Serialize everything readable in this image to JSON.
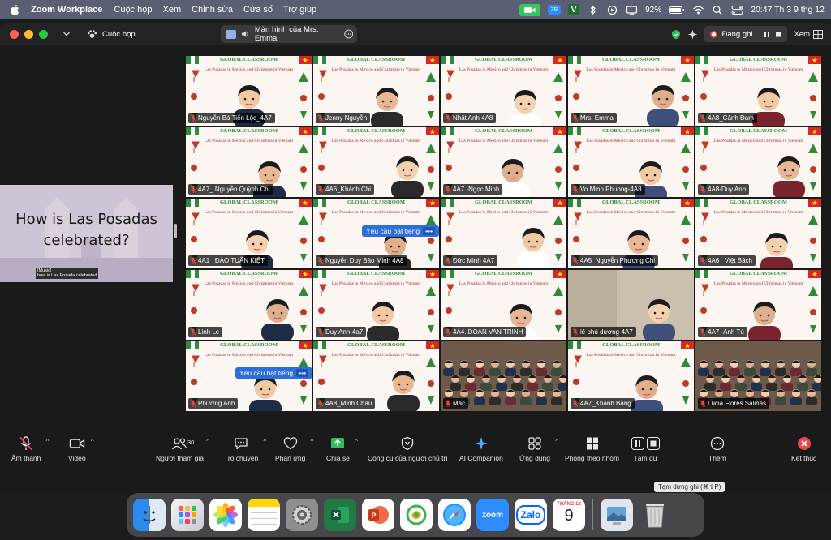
{
  "menubar": {
    "app_name": "Zoom Workplace",
    "items": [
      "Cuộc họp",
      "Xem",
      "Chỉnh sửa",
      "Cửa sổ",
      "Trợ giúp"
    ],
    "zoom_badge": "ZR",
    "v_badge": "V",
    "battery": "92%",
    "clock": "20:47 Th 3 9 thg 12"
  },
  "window": {
    "meeting_label": "Cuộc họp",
    "share_tab_label": "Màn hình của Mrs. Emma",
    "recording_label": "Đang ghi...",
    "view_label": "Xem"
  },
  "shared_screen": {
    "title": "How is Las Posadas celebrated?",
    "caption_line1": "[Music]",
    "caption_line2": "how is Las Posada celebrated"
  },
  "slide": {
    "header": "GLOBAL CLASSROOM",
    "line1": "Las Posadas in Mexico and",
    "line2": "Christmas in Vietnam"
  },
  "participants": [
    {
      "name": "Nguyễn Bá Tiến Lộc_4A7",
      "kind": "slide"
    },
    {
      "name": "Jenny Nguyễn",
      "kind": "slide"
    },
    {
      "name": "Nhật Anh 4A8",
      "kind": "slide"
    },
    {
      "name": "Mrs. Emma",
      "kind": "slide",
      "active": true
    },
    {
      "name": "4A8_Cảnh Đam",
      "kind": "slide"
    },
    {
      "name": "4A7_ Nguyễn Quỳnh Chi",
      "kind": "slide"
    },
    {
      "name": "4A6_Khánh Chi",
      "kind": "slide"
    },
    {
      "name": "4A7 -Ngọc Minh",
      "kind": "slide"
    },
    {
      "name": "Vo Minh Phuong-4A8",
      "kind": "slide"
    },
    {
      "name": "4A8-Duy Anh",
      "kind": "slide"
    },
    {
      "name": "4A1_ ĐÀO TUẤN KIỆT",
      "kind": "slide"
    },
    {
      "name": "Nguyễn Duy Bảo Minh 4A8",
      "kind": "slide"
    },
    {
      "name": "Đức Minh 4A7",
      "kind": "slide"
    },
    {
      "name": "4A5_Nguyễn Phương Chi",
      "kind": "slide"
    },
    {
      "name": "4A6_ Việt Bách",
      "kind": "slide"
    },
    {
      "name": "Linh Le",
      "kind": "slide"
    },
    {
      "name": "Duy Anh-4a7",
      "kind": "slide"
    },
    {
      "name": "4A4. DOAN VAN TRINH",
      "kind": "slide"
    },
    {
      "name": "lê phú dương-4A7",
      "kind": "video"
    },
    {
      "name": "4A7 -Anh Tú",
      "kind": "slide"
    },
    {
      "name": "Phương Anh",
      "kind": "slide"
    },
    {
      "name": "4A8_Minh Châu",
      "kind": "slide"
    },
    {
      "name": "Mac",
      "kind": "classroom"
    },
    {
      "name": "4A7_Khánh Băng",
      "kind": "slide"
    },
    {
      "name": "Lucia Flores Salinas",
      "kind": "classroom"
    }
  ],
  "unmute_requests": {
    "label": "Yêu cầu bật tiếng",
    "more": "•••"
  },
  "toolbar": {
    "mute": "Âm thanh",
    "video": "Video",
    "participants": "Người tham gia",
    "participants_count": "30",
    "chat": "Trò chuyện",
    "reactions": "Phản ứng",
    "share": "Chia sẻ",
    "host_tools": "Công cụ của người chủ trì",
    "ai_companion": "AI Companion",
    "apps": "Ứng dụng",
    "breakout": "Phòng theo nhóm",
    "record": "Tạm dừ",
    "more": "Thêm",
    "end": "Kết thúc",
    "stop_tooltip": "Tạm dừng ghi (⌘⇧P)"
  },
  "dock": {
    "zoom": "zoom",
    "zalo": "Zalo",
    "calendar_month": "THÁNG 12",
    "calendar_day": "9"
  },
  "colors": {
    "accent_blue": "#2d8cff",
    "active_speaker": "#43c25b",
    "end_red": "#e5484d"
  }
}
